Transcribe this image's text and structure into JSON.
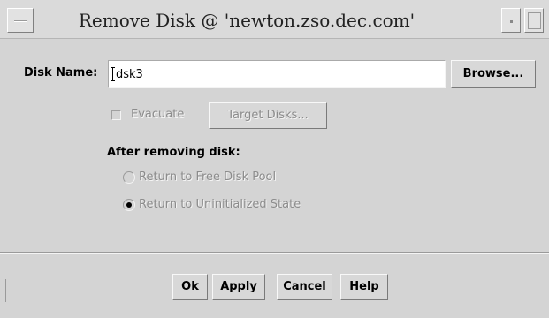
{
  "window": {
    "title": "Remove Disk @ 'newton.zso.dec.com'"
  },
  "disk_name": {
    "label": "Disk Name:",
    "value": "dsk3",
    "browse_label": "Browse..."
  },
  "evacuate": {
    "label": "Evacuate",
    "checked": false,
    "enabled": false,
    "target_disks_label": "Target Disks..."
  },
  "after_removing": {
    "heading": "After removing disk:",
    "options": [
      {
        "label": "Return to Free Disk Pool",
        "selected": false,
        "enabled": false
      },
      {
        "label": "Return to Uninitialized State",
        "selected": true,
        "enabled": false
      }
    ]
  },
  "buttons": {
    "ok": "Ok",
    "apply": "Apply",
    "cancel": "Cancel",
    "help": "Help"
  }
}
